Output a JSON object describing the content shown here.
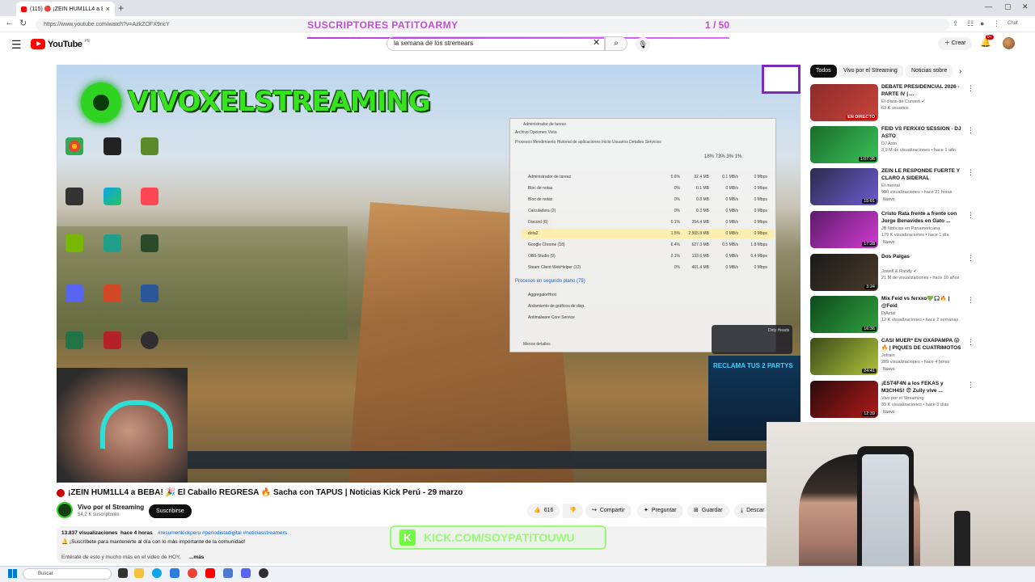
{
  "browser": {
    "tab_title": "(115) 🔴 ¡ZEIN HUM1LL4 a BEBA!",
    "url": "https://www.youtube.com/watch?v=AzkZOFX9ncY",
    "chat_label": "Chat"
  },
  "overlay": {
    "title": "SUSCRIPTORES PATITOARMY",
    "count": "1 / 50",
    "kick_url": "KICK.COM/SOYPATITOUWU",
    "kick_letter": "K"
  },
  "header": {
    "logo_text": "YouTube",
    "country": "PE",
    "search_value": "la semana de los stremears",
    "create_label": "Crear",
    "notif_badge": "9+"
  },
  "stream": {
    "channel_overlay": "VIVOXELSTREAMING",
    "reclama_text": "RECLAMA TUS 2 PARTYS",
    "dirty_heads": "Dirty Heads"
  },
  "taskmanager": {
    "title": "Administrador de tareas",
    "menu": "Archivo   Opciones   Vista",
    "tabs": "Procesos   Rendimiento   Historial de aplicaciones   Inicio   Usuarios   Detalles   Servicios",
    "cols": "18%   73%   3%   1%",
    "processes": [
      {
        "name": "Administrador de tareas",
        "cpu": "0.6%",
        "mem": "32.4 MB",
        "disk": "0.1 MB/s",
        "net": "0 Mbps",
        "hl": false
      },
      {
        "name": "Bloc de notas",
        "cpu": "0%",
        "mem": "0.1 MB",
        "disk": "0 MB/s",
        "net": "0 Mbps",
        "hl": false
      },
      {
        "name": "Bloc de notas",
        "cpu": "0%",
        "mem": "0.8 MB",
        "disk": "0 MB/s",
        "net": "0 Mbps",
        "hl": false
      },
      {
        "name": "Calculadora (2)",
        "cpu": "0%",
        "mem": "0.3 MB",
        "disk": "0 MB/s",
        "net": "0 Mbps",
        "hl": false
      },
      {
        "name": "Discord (6)",
        "cpu": "0.1%",
        "mem": "354.4 MB",
        "disk": "0 MB/s",
        "net": "0 Mbps",
        "hl": false
      },
      {
        "name": "dota2",
        "cpu": "1.5%",
        "mem": "2,505.8 MB",
        "disk": "0 MB/s",
        "net": "0 Mbps",
        "hl": true
      },
      {
        "name": "Google Chrome (18)",
        "cpu": "6.4%",
        "mem": "627.3 MB",
        "disk": "0.5 MB/s",
        "net": "1.8 Mbps",
        "hl": false
      },
      {
        "name": "OBS Studio (9)",
        "cpu": "2.1%",
        "mem": "133.6 MB",
        "disk": "0 MB/s",
        "net": "6.4 Mbps",
        "hl": false
      },
      {
        "name": "Steam Client WebHelper (12)",
        "cpu": "0%",
        "mem": "401.4 MB",
        "disk": "0 MB/s",
        "net": "0 Mbps",
        "hl": false
      }
    ],
    "background_header": "Procesos en segundo plano (75)",
    "bg_processes": [
      "AggregatorHost",
      "Aislamiento de gráficos de disp.",
      "Antimalware Core Service"
    ],
    "footer": "Menos detalles"
  },
  "desktop_icons": [
    "Google Chrome",
    "Steam",
    "Minecraft",
    "EasyAntiCheat",
    "Microsoft Edge",
    "VALORANT",
    "NVIDIA App",
    "FurMark",
    "Asset Store",
    "Discord",
    "PowerPoint",
    "Word",
    "Excel",
    "Riot Client",
    "OBS Studio"
  ],
  "video": {
    "title": "¡ZEIN HUM1LL4 a BEBA! 🎉 El Caballo REGRESA 🔥 Sacha con TAPUS | Noticias Kick Perú - 29 marzo",
    "channel": "Vivo por el Streaming",
    "subs": "54,2 K suscriptores",
    "subscribe": "Suscribirse",
    "likes": "616",
    "share": "Compartir",
    "ask": "Preguntar",
    "save": "Guardar",
    "download": "Descar",
    "views": "13.837 visualizaciones",
    "time": "hace 4 horas",
    "tags": "#resumenkickperu #periodistadigital #noticiasstreamers",
    "desc_line": "🔔 ¡Suscríbete para mantenerte al día con lo más importante de la comunidad!",
    "desc_line3": "Entérate de esto y mucho más en el video de HOY.",
    "more": "...más"
  },
  "chips": [
    "Todos",
    "Vivo por el Streaming",
    "Noticias sobre"
  ],
  "recommendations": [
    {
      "title": "DEBATE PRESIDENCIAL 2026 - PARTE IV | ...",
      "channel": "El diario de Curwen ✔",
      "meta": "63 K usuarios",
      "badge": "EN DIRECTO",
      "live": true,
      "new": "",
      "colors": [
        "#8b2b2b",
        "#c9433b"
      ]
    },
    {
      "title": "FEID VS FERXXO SESSION - DJ ASTO",
      "channel": "DJ Asto",
      "meta": "3,9 M de visualizaciones • hace 1 año",
      "badge": "1:07:36",
      "live": false,
      "new": "",
      "colors": [
        "#1b6b2b",
        "#3ac25a"
      ]
    },
    {
      "title": "ZEIN LE RESPONDE FUERTE Y CLARO A SIDERAL",
      "channel": "El mental",
      "meta": "980 visualizaciones • hace 21 horas",
      "badge": "15:01",
      "live": false,
      "new": "Nuevo",
      "colors": [
        "#2b2b4b",
        "#6c5bd1"
      ]
    },
    {
      "title": "Cristo Rata frente a frente con Jorge Benavides en Gato ...",
      "channel": "JB Noticias en Panamericana",
      "meta": "179 K visualizaciones • hace 1 día",
      "badge": "17:28",
      "live": false,
      "new": "Nuevo",
      "colors": [
        "#5b1b6b",
        "#d13ad1"
      ]
    },
    {
      "title": "Dos Palgas",
      "channel": "Jowell & Randy ✔",
      "meta": "21 M de visualizaciones • hace 10 años",
      "badge": "3:24",
      "live": false,
      "new": "",
      "colors": [
        "#1a1a1a",
        "#4a3a2a"
      ]
    },
    {
      "title": "Mix Feid vs ferxxo💚🎧🔥 | @Feid",
      "channel": "DjActal",
      "meta": "12 K visualizaciones • hace 2 semanas",
      "badge": "16:36",
      "live": false,
      "new": "",
      "colors": [
        "#0e4a1b",
        "#2fa03f"
      ]
    },
    {
      "title": "CASI MUER* EN OXAPAMPA 😱 🔥 | PIQUES DE CUATRIMOTOS",
      "channel": "Jefrain",
      "meta": "289 visualizaciones • hace 4 horas",
      "badge": "24:41",
      "live": false,
      "new": "Nuevo",
      "colors": [
        "#3a4a1a",
        "#b0c23a"
      ]
    },
    {
      "title": "¡EST4F4N a los FEKAS y M3CH4S! 😨 Zully vive ...",
      "channel": "Vivo por el Streaming",
      "meta": "39 K visualizaciones • hace 3 días",
      "badge": "12:39",
      "live": false,
      "new": "Nuevo",
      "colors": [
        "#2a0a0a",
        "#b01a1a"
      ]
    }
  ],
  "taskbar": {
    "search_placeholder": "Buscar"
  },
  "colors": {
    "accent_red": "#ff0000",
    "overlay_purple": "#c54ad8",
    "kick_green": "#53fc18",
    "stream_green": "#37e21f"
  }
}
